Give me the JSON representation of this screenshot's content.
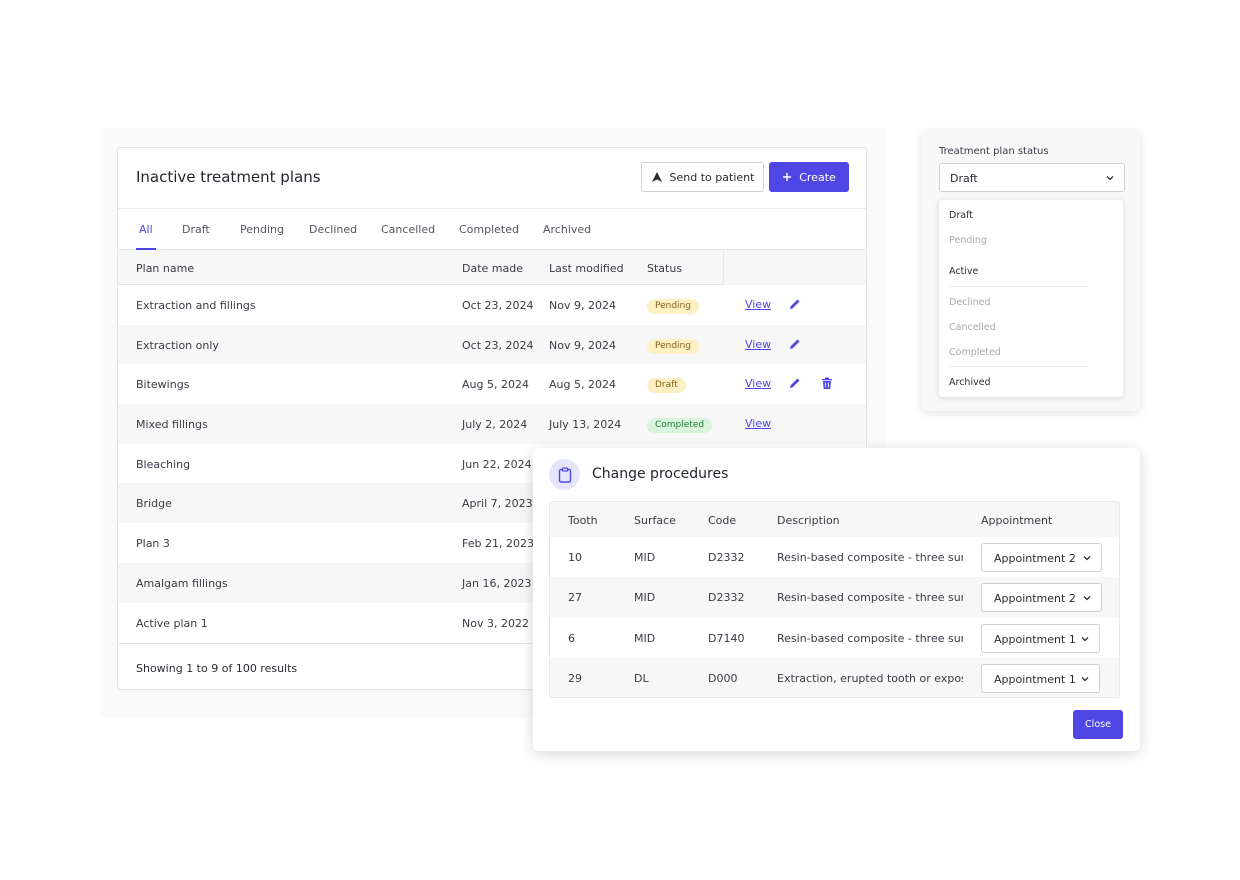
{
  "plans": {
    "title": "Inactive treatment plans",
    "send_label": "Send to patient",
    "create_label": "Create",
    "tabs": [
      "All",
      "Draft",
      "Pending",
      "Declined",
      "Cancelled",
      "Completed",
      "Archived"
    ],
    "columns": [
      "Plan name",
      "Date made",
      "Last modified",
      "Status"
    ],
    "view_label": "View",
    "rows": [
      {
        "name": "Extraction and fillings",
        "made": "Oct 23, 2024",
        "modified": "Nov 9, 2024",
        "status": "Pending"
      },
      {
        "name": "Extraction only",
        "made": "Oct 23, 2024",
        "modified": "Nov 9, 2024",
        "status": "Pending"
      },
      {
        "name": "Bitewings",
        "made": "Aug 5, 2024",
        "modified": "Aug 5, 2024",
        "status": "Draft"
      },
      {
        "name": "Mixed fillings",
        "made": "July 2, 2024",
        "modified": "July 13, 2024",
        "status": "Completed"
      },
      {
        "name": "Bleaching",
        "made": "Jun 22, 2024"
      },
      {
        "name": "Bridge",
        "made": "April 7, 2023"
      },
      {
        "name": "Plan 3",
        "made": "Feb 21, 2023"
      },
      {
        "name": "Amalgam fillings",
        "made": "Jan 16, 2023"
      },
      {
        "name": "Active plan 1",
        "made": "Nov 3, 2022"
      }
    ],
    "footer": "Showing 1 to 9 of 100 results"
  },
  "status_dropdown": {
    "label": "Treatment plan status",
    "selected": "Draft",
    "options": [
      "Draft",
      "Pending",
      "Active",
      "Declined",
      "Cancelled",
      "Completed",
      "Archived"
    ]
  },
  "procedures": {
    "title": "Change procedures",
    "columns": [
      "Tooth",
      "Surface",
      "Code",
      "Description",
      "Appointment"
    ],
    "rows": [
      {
        "tooth": "10",
        "surface": "MID",
        "code": "D2332",
        "description": "Resin-based composite - three surfaces",
        "appointment": "Appointment 2"
      },
      {
        "tooth": "27",
        "surface": "MID",
        "code": "D2332",
        "description": "Resin-based composite - three surfaces",
        "appointment": "Appointment 2"
      },
      {
        "tooth": "6",
        "surface": "MID",
        "code": "D7140",
        "description": "Resin-based composite - three surfaces",
        "appointment": "Appointment 1"
      },
      {
        "tooth": "29",
        "surface": "DL",
        "code": "D000",
        "description": "Extraction, erupted tooth or exposed",
        "appointment": "Appointment 1"
      }
    ],
    "close_label": "Close"
  },
  "colors": {
    "accent": "#4f46e5",
    "pending_bg": "#fdf0c4",
    "completed_bg": "#d8f5dc"
  }
}
